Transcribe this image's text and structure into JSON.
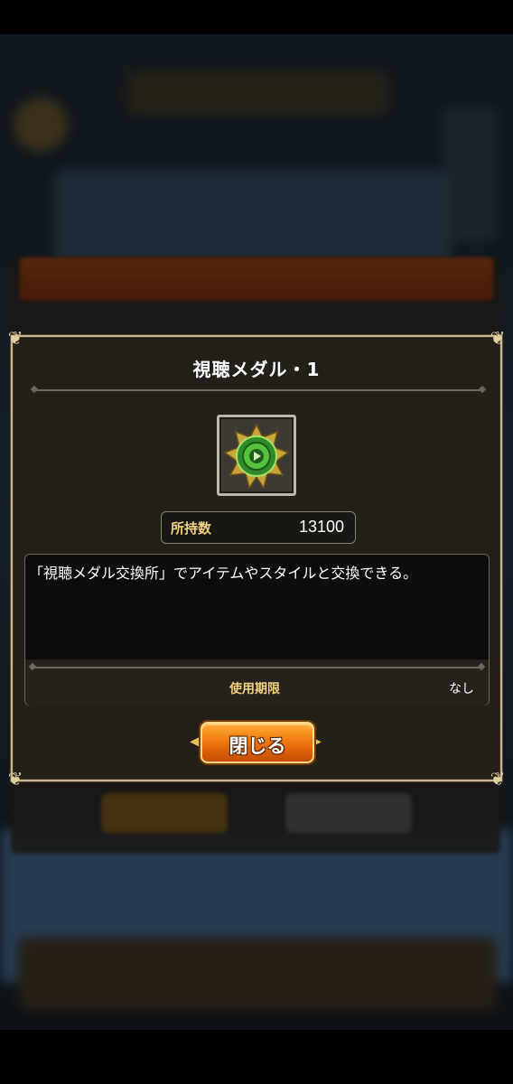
{
  "modal": {
    "title": "視聴メダル・1",
    "item_icon": "green-play-medal-icon",
    "owned_label": "所持数",
    "owned_value": "13100",
    "description": "「視聴メダル交換所」でアイテムやスタイルと交換できる。",
    "expiry_label": "使用期限",
    "expiry_value": "なし",
    "close_label": "閉じる"
  },
  "colors": {
    "accent_gold": "#f2d27e",
    "button_orange": "#f07a10",
    "modal_bg": "#232019"
  }
}
